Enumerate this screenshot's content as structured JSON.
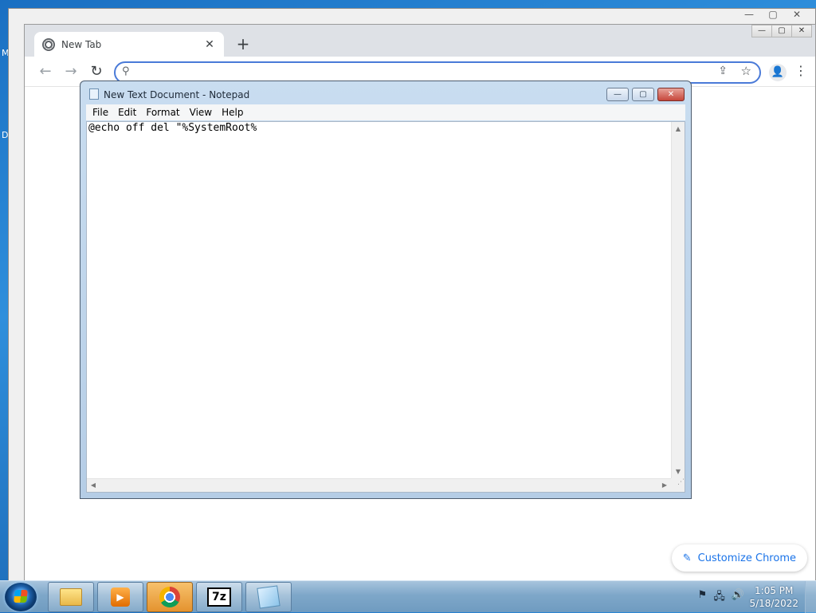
{
  "desktop": {
    "side_letters": [
      "M",
      "D"
    ]
  },
  "back_window": {
    "controls": [
      "—",
      "▢",
      "✕"
    ]
  },
  "chrome": {
    "controls": [
      "—",
      "▢",
      "✕"
    ],
    "tab": {
      "title": "New Tab",
      "close": "✕"
    },
    "new_tab": "+",
    "nav": {
      "back": "←",
      "forward": "→",
      "reload": "↻"
    },
    "omnibox": {
      "search_icon": "⚲",
      "value": "",
      "share_icon": "⇪",
      "star_icon": "☆"
    },
    "profile_icon": "👤",
    "menu_icon": "⋮",
    "customize": {
      "icon": "✎",
      "label": "Customize Chrome"
    }
  },
  "notepad": {
    "title": "New Text Document - Notepad",
    "controls": {
      "minimize": "—",
      "maximize": "▢",
      "close": "✕"
    },
    "menu": [
      "File",
      "Edit",
      "Format",
      "View",
      "Help"
    ],
    "content": "@echo off del \"%SystemRoot%",
    "scroll": {
      "up": "▲",
      "down": "▼",
      "left": "◀",
      "right": "▶",
      "grip": "⋰"
    }
  },
  "taskbar": {
    "apps": [
      {
        "name": "explorer",
        "icon": "folder-icon"
      },
      {
        "name": "media-player",
        "icon": "media-player-icon",
        "glyph": "▶"
      },
      {
        "name": "chrome",
        "icon": "chrome-icon"
      },
      {
        "name": "7-zip",
        "icon": "7zip-icon",
        "glyph": "7z"
      },
      {
        "name": "notepad",
        "icon": "notepad-icon"
      }
    ],
    "tray": {
      "flag": "⚑",
      "network": "🖧",
      "volume": "🔊"
    },
    "clock": {
      "time": "1:05 PM",
      "date": "5/18/2022"
    }
  }
}
